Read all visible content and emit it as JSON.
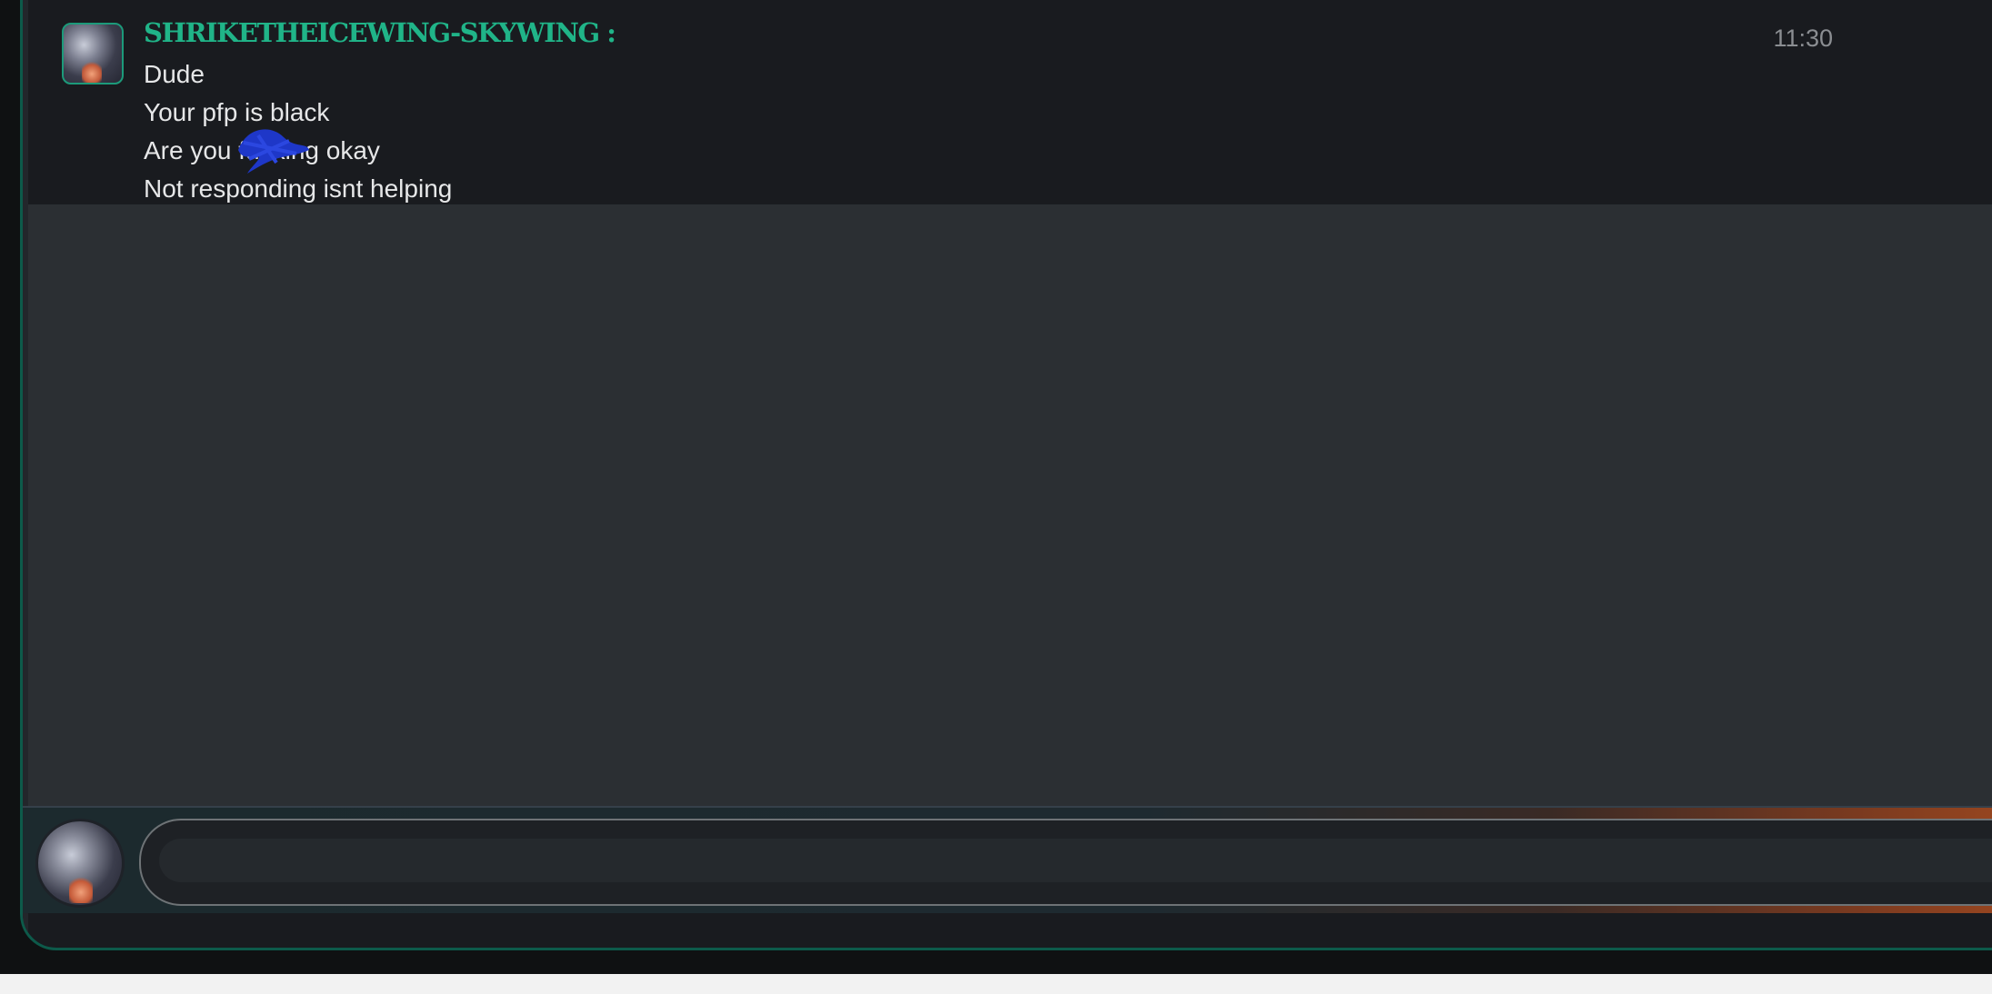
{
  "message": {
    "username": "SHRIKETHEICEWING-SKYWING :",
    "timestamp": "11:30",
    "lines": [
      {
        "text": "Dude"
      },
      {
        "text": "Your pfp is black"
      },
      {
        "before": "Are you ",
        "redacted": "fucking",
        "after": " okay"
      },
      {
        "text": "Not responding isnt helping"
      }
    ]
  },
  "composer": {
    "value": "",
    "placeholder": ""
  },
  "colors": {
    "username": "#20b488",
    "scribble": "#1e37c8"
  },
  "icons": {
    "scribble": "redaction-scribble"
  }
}
